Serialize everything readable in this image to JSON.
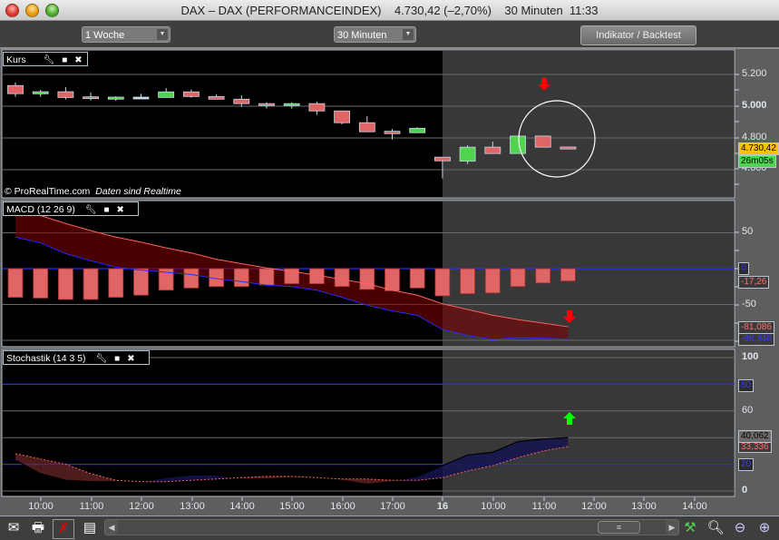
{
  "window": {
    "title": "DAX – DAX (PERFORMANCEINDEX)    4.730,42 (–2,70%)    30 Minuten  11:33"
  },
  "toolbar": {
    "period": "1 Woche",
    "interval": "30 Minuten",
    "indicator_button": "Indikator / Backtest"
  },
  "colors": {
    "bull": "#4fd44f",
    "bear": "#e06666",
    "macd_line": "#2a2aff",
    "signal_line": "#ff6060",
    "current_price_bg": "#ffc000",
    "countdown_bg": "#4fd44f"
  },
  "price_panel": {
    "title": "Kurs",
    "copyright": "© ProRealTime.com",
    "realtime_note": "Daten sind Realtime",
    "y_ticks": [
      "5.200",
      "5.000",
      "4.800",
      "4.600"
    ],
    "current_price": "4.730,42",
    "countdown": "26m05s",
    "candles": [
      {
        "t": "09:30",
        "o": 5130,
        "h": 5149,
        "l": 5059,
        "c": 5079
      },
      {
        "t": "10:00",
        "o": 5078,
        "h": 5103,
        "l": 5059,
        "c": 5091
      },
      {
        "t": "10:30",
        "o": 5091,
        "h": 5120,
        "l": 5042,
        "c": 5055
      },
      {
        "t": "11:00",
        "o": 5059,
        "h": 5086,
        "l": 5036,
        "c": 5052
      },
      {
        "t": "11:30",
        "o": 5044,
        "h": 5063,
        "l": 5033,
        "c": 5057
      },
      {
        "t": "12:00",
        "o": 5057,
        "h": 5078,
        "l": 5046,
        "c": 5057
      },
      {
        "t": "12:30",
        "o": 5055,
        "h": 5114,
        "l": 5055,
        "c": 5090
      },
      {
        "t": "13:00",
        "o": 5090,
        "h": 5105,
        "l": 5053,
        "c": 5061
      },
      {
        "t": "13:30",
        "o": 5061,
        "h": 5074,
        "l": 5044,
        "c": 5044
      },
      {
        "t": "14:00",
        "o": 5044,
        "h": 5069,
        "l": 4996,
        "c": 5016
      },
      {
        "t": "14:30",
        "o": 5016,
        "h": 5025,
        "l": 4985,
        "c": 5004
      },
      {
        "t": "15:00",
        "o": 5004,
        "h": 5025,
        "l": 4985,
        "c": 5016
      },
      {
        "t": "15:30",
        "o": 5016,
        "h": 5029,
        "l": 4945,
        "c": 4970
      },
      {
        "t": "16:00",
        "o": 4970,
        "h": 4970,
        "l": 4885,
        "c": 4896
      },
      {
        "t": "16:30",
        "o": 4896,
        "h": 4938,
        "l": 4839,
        "c": 4839
      },
      {
        "t": "17:00",
        "o": 4842,
        "h": 4856,
        "l": 4791,
        "c": 4827
      },
      {
        "t": "17:30",
        "o": 4833,
        "h": 4867,
        "l": 4833,
        "c": 4861
      },
      {
        "t": "09:00",
        "o": 4679,
        "h": 4679,
        "l": 4545,
        "c": 4656
      },
      {
        "t": "09:30",
        "o": 4654,
        "h": 4754,
        "l": 4636,
        "c": 4742
      },
      {
        "t": "10:00",
        "o": 4742,
        "h": 4777,
        "l": 4702,
        "c": 4702
      },
      {
        "t": "10:30",
        "o": 4702,
        "h": 4812,
        "l": 4702,
        "c": 4812
      },
      {
        "t": "11:00",
        "o": 4812,
        "h": 4812,
        "l": 4742,
        "c": 4742
      },
      {
        "t": "11:30",
        "o": 4743,
        "h": 4743,
        "l": 4730,
        "c": 4730.42
      }
    ]
  },
  "macd_panel": {
    "title": "MACD (12 26 9)",
    "y_ticks": [
      "50",
      "-50"
    ],
    "zero_label": "0",
    "histogram_label": "-17,26",
    "signal_label": "-81,086",
    "macd_label": "-98,346",
    "histogram": [
      -40,
      -41,
      -43,
      -43,
      -40,
      -37,
      -30,
      -27,
      -25,
      -25,
      -23,
      -21,
      -21,
      -25,
      -29,
      -31,
      -27,
      -38,
      -35,
      -34,
      -25,
      -20,
      -17.26
    ],
    "signal": [
      80,
      74,
      63,
      53,
      44,
      37,
      29,
      22,
      13,
      7,
      1,
      -4,
      -9,
      -15,
      -21,
      -30,
      -37,
      -49,
      -57,
      -65,
      -71,
      -76,
      -81.086
    ],
    "macd": [
      44,
      36,
      21,
      11,
      2,
      -2,
      -5,
      -8,
      -14,
      -18,
      -23,
      -25,
      -30,
      -40,
      -51,
      -59,
      -65,
      -85,
      -93,
      -99,
      -96,
      -97,
      -98.346
    ]
  },
  "stoch_panel": {
    "title": "Stochastik (14 3 5)",
    "y_ticks": [
      "100",
      "60",
      "0"
    ],
    "upper_level": "80",
    "lower_level": "20",
    "k_label": "40,062",
    "d_label": "33,336",
    "k": [
      23,
      13,
      8,
      7,
      7,
      7,
      10,
      12,
      12,
      9,
      9,
      10,
      10,
      8,
      5,
      7,
      11,
      19,
      27,
      29,
      37,
      39,
      40.062
    ],
    "d": [
      28,
      24,
      20,
      13,
      8,
      7,
      7,
      8,
      9,
      10,
      11,
      11,
      10,
      9,
      9,
      8,
      8,
      10,
      15,
      19,
      25,
      30,
      33.336
    ]
  },
  "time_axis": [
    "10:00",
    "11:00",
    "12:00",
    "13:00",
    "14:00",
    "15:00",
    "16:00",
    "17:00",
    "16",
    "10:00",
    "11:00",
    "12:00",
    "13:00",
    "14:00"
  ],
  "bottom_toolbar": {
    "icons": [
      "mail-icon",
      "print-icon",
      "link-off-icon",
      "report-icon",
      "indicator-edit-icon",
      "zoom-fit-icon",
      "zoom-out-icon",
      "zoom-in-icon"
    ],
    "scroll_thumb": "≡"
  }
}
